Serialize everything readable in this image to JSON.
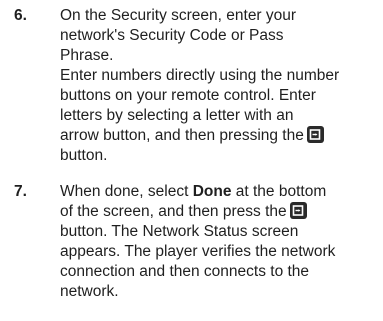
{
  "steps": [
    {
      "number": "6.",
      "lines": [
        "On the Security screen, enter your",
        "network's Security Code or Pass",
        "Phrase.",
        "Enter numbers directly using the number",
        "buttons on your remote control. Enter",
        "letters by selecting a letter with an",
        "arrow button, and then pressing the",
        "button."
      ],
      "icon": "enter-button-icon"
    },
    {
      "number": "7.",
      "line1_prefix": "When done, select ",
      "line1_bold": "Done",
      "line1_suffix": " at the bottom",
      "line2": "of the screen, and then press the",
      "lines_rest": [
        "button. The Network Status screen",
        "appears. The player verifies the network",
        "connection and then connects to the",
        "network."
      ],
      "icon": "enter-button-icon"
    }
  ]
}
